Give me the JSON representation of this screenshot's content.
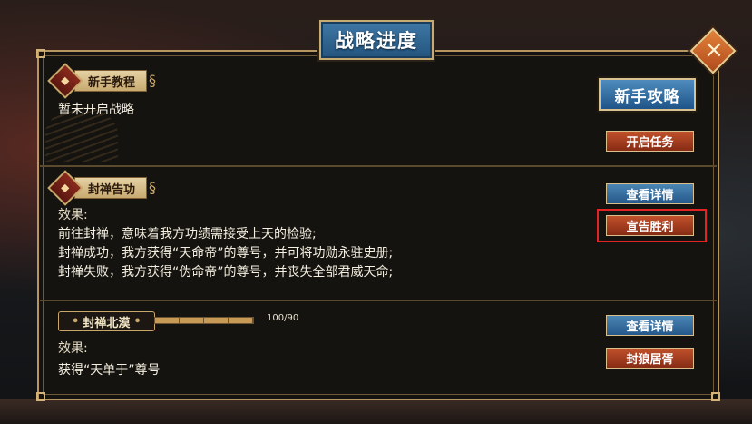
{
  "window": {
    "title": "战略进度"
  },
  "colors": {
    "accent_blue": "#2f6c9c",
    "accent_red": "#b04220",
    "frame_gold": "#b79660",
    "highlight": "#e32424"
  },
  "icons": {
    "close": "close-icon",
    "tag": "scroll-tag-icon"
  },
  "sections": [
    {
      "tag": "新手教程",
      "lines": [
        "暂未开启战略"
      ],
      "buttons": [
        "新手攻略",
        "开启任务"
      ]
    },
    {
      "tag": "封禅告功",
      "effect_label": "效果:",
      "lines": [
        "前往封禅，意味着我方功绩需接受上天的检验;",
        "封禅成功，我方获得“天命帝”的尊号，并可将功勋永驻史册;",
        "封禅失败，我方获得“伪命帝”的尊号，并丧失全部君威天命;"
      ],
      "buttons": [
        "查看详情",
        "宣告胜利"
      ]
    },
    {
      "tag": "封禅北漠",
      "progress": {
        "current": 100,
        "total": 90,
        "text": "100/90",
        "fraction": 1.0
      },
      "effect_label": "效果:",
      "lines": [
        "获得“天单于”尊号"
      ],
      "buttons": [
        "查看详情",
        "封狼居胥"
      ]
    }
  ]
}
